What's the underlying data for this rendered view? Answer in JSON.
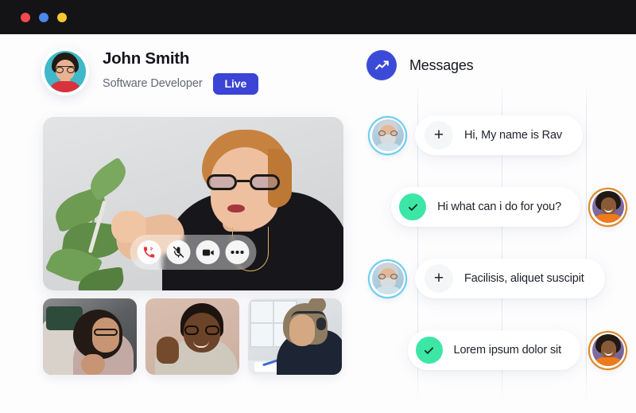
{
  "window": {
    "traffic_lights": [
      {
        "name": "close",
        "color": "#f1494e"
      },
      {
        "name": "minimize",
        "color": "#4a87ee"
      },
      {
        "name": "maximize",
        "color": "#f5c731"
      }
    ]
  },
  "profile": {
    "name": "John Smith",
    "role": "Software Developer",
    "status_badge": "Live",
    "badge_color": "#3b44d4",
    "avatar_name": "john-smith-avatar"
  },
  "video": {
    "main_speaker_label": "main-video-feed",
    "controls": [
      {
        "name": "end-call-button",
        "icon": "phone-hangup-icon",
        "color": "#e8333f"
      },
      {
        "name": "mute-mic-button",
        "icon": "microphone-muted-icon",
        "color": "#1c1c1e"
      },
      {
        "name": "camera-button",
        "icon": "video-camera-icon",
        "color": "#1c1c1e"
      },
      {
        "name": "more-options-button",
        "icon": "more-horizontal-icon",
        "color": "#1c1c1e"
      }
    ],
    "thumbnails": [
      {
        "name": "participant-thumbnail-1"
      },
      {
        "name": "participant-thumbnail-2"
      },
      {
        "name": "participant-thumbnail-3"
      }
    ]
  },
  "messages": {
    "title": "Messages",
    "icon": "trending-up-icon",
    "icon_color": "#3b4bd8",
    "items": [
      {
        "text": "Hi, My name is Rav",
        "side": "left",
        "chip": "plus",
        "chip_label": "+",
        "avatar": "sender-avatar-older-man",
        "ring_color": "#6fd0ef"
      },
      {
        "text": "Hi what can i do for you?",
        "side": "right",
        "chip": "check",
        "chip_label": "✓",
        "avatar": "sender-avatar-curly-woman",
        "ring_color": "#e08a2a"
      },
      {
        "text": "Facilisis, aliquet suscipit",
        "side": "left",
        "chip": "plus",
        "chip_label": "+",
        "avatar": "sender-avatar-older-man",
        "ring_color": "#6fd0ef"
      },
      {
        "text": "Lorem ipsum dolor sit",
        "side": "right",
        "chip": "check",
        "chip_label": "✓",
        "avatar": "sender-avatar-curly-woman",
        "ring_color": "#e08a2a"
      }
    ]
  }
}
